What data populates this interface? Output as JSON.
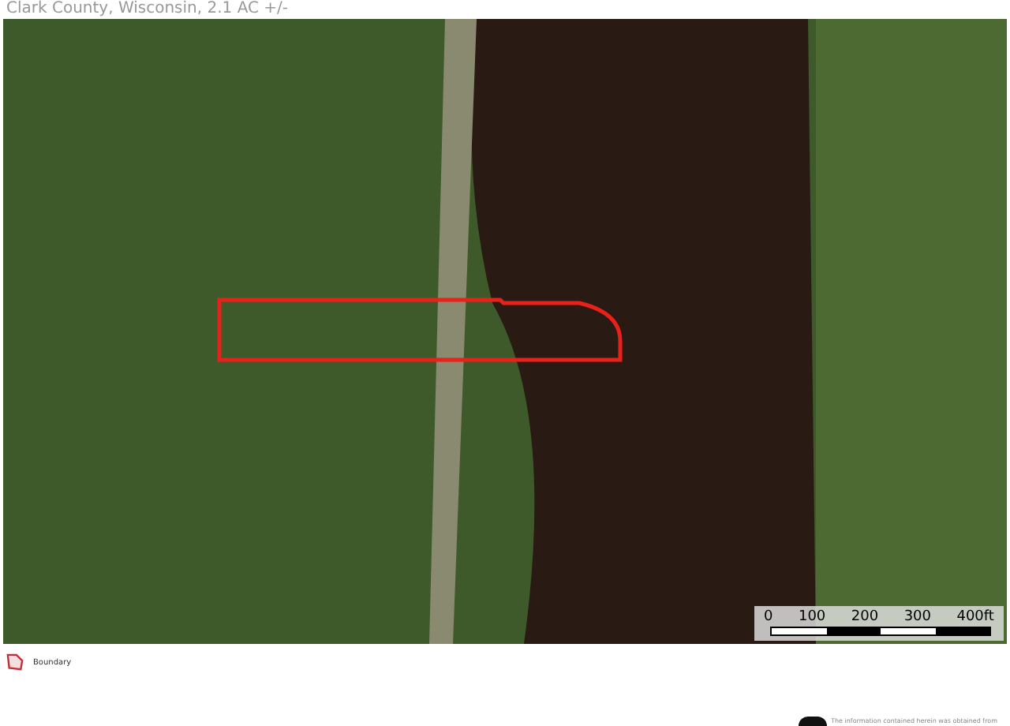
{
  "title": "Clark County, Wisconsin, 2.1 AC +/-",
  "scale_bar": {
    "labels": [
      "0",
      "100",
      "200",
      "300",
      "400ft"
    ]
  },
  "legend": [
    {
      "label": "Boundary"
    }
  ],
  "disclaimer": "The information contained herein was obtained from"
}
